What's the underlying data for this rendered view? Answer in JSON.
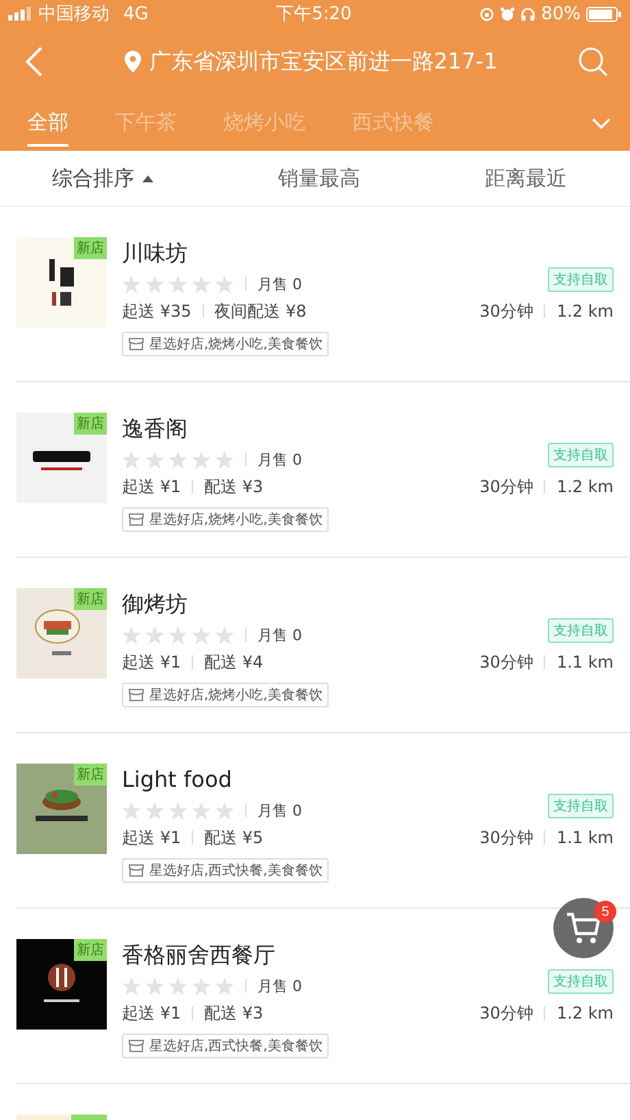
{
  "status_bar": {
    "carrier": "中国移动",
    "network": "4G",
    "time": "下午5:20",
    "battery": "80%"
  },
  "header": {
    "location": "广东省深圳市宝安区前进一路217-1"
  },
  "tabs": [
    {
      "label": "全部",
      "selected": true
    },
    {
      "label": "下午茶",
      "selected": false
    },
    {
      "label": "烧烤小吃",
      "selected": false
    },
    {
      "label": "西式快餐",
      "selected": false
    }
  ],
  "sort_options": [
    {
      "label": "综合排序",
      "selected": true
    },
    {
      "label": "销量最高",
      "selected": false
    },
    {
      "label": "距离最近",
      "selected": false
    }
  ],
  "stores": [
    {
      "name": "川味坊",
      "new_badge": "新店",
      "stars": 0,
      "monthly_sales": "月售 0",
      "min_order": "起送 ¥35",
      "delivery_fee": "夜间配送 ¥8",
      "pickup_badge": "支持自取",
      "delivery_time": "30分钟",
      "distance": "1.2 km",
      "tags": "星选好店,烧烤小吃,美食餐饮"
    },
    {
      "name": "逸香阁",
      "new_badge": "新店",
      "stars": 0,
      "monthly_sales": "月售 0",
      "min_order": "起送 ¥1",
      "delivery_fee": "配送 ¥3",
      "pickup_badge": "支持自取",
      "delivery_time": "30分钟",
      "distance": "1.2 km",
      "tags": "星选好店,烧烤小吃,美食餐饮"
    },
    {
      "name": "御烤坊",
      "new_badge": "新店",
      "stars": 0,
      "monthly_sales": "月售 0",
      "min_order": "起送 ¥1",
      "delivery_fee": "配送 ¥4",
      "pickup_badge": "支持自取",
      "delivery_time": "30分钟",
      "distance": "1.1 km",
      "tags": "星选好店,烧烤小吃,美食餐饮"
    },
    {
      "name": "Light food",
      "new_badge": "新店",
      "stars": 0,
      "monthly_sales": "月售 0",
      "min_order": "起送 ¥1",
      "delivery_fee": "配送 ¥5",
      "pickup_badge": "支持自取",
      "delivery_time": "30分钟",
      "distance": "1.1 km",
      "tags": "星选好店,西式快餐,美食餐饮"
    },
    {
      "name": "香格丽舍西餐厅",
      "new_badge": "新店",
      "stars": 0,
      "monthly_sales": "月售 0",
      "min_order": "起送 ¥1",
      "delivery_fee": "配送 ¥3",
      "pickup_badge": "支持自取",
      "delivery_time": "30分钟",
      "distance": "1.2 km",
      "tags": "星选好店,西式快餐,美食餐饮"
    }
  ],
  "cart": {
    "count": "5"
  }
}
